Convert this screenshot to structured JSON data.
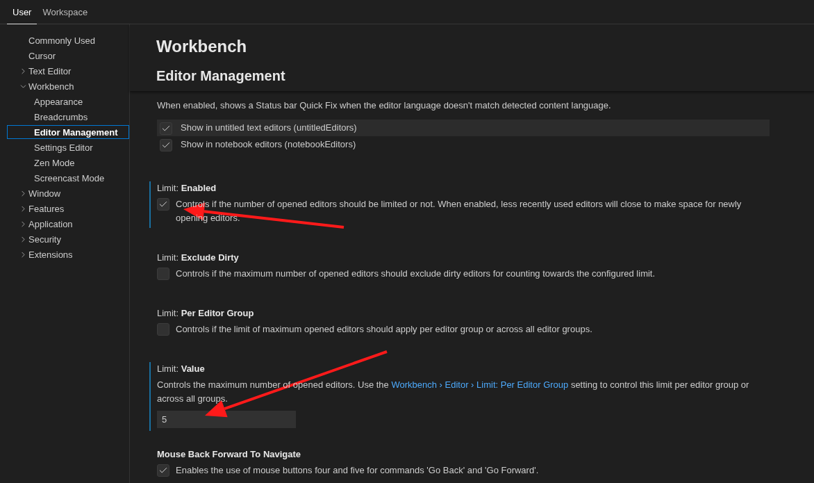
{
  "tabs": [
    {
      "label": "User",
      "selected": true
    },
    {
      "label": "Workspace",
      "selected": false
    }
  ],
  "sidebar": {
    "items": [
      {
        "label": "Commonly Used",
        "selected": false
      },
      {
        "label": "Cursor",
        "selected": false
      },
      {
        "label": "Text Editor",
        "selected": false,
        "expanded": false
      },
      {
        "label": "Workbench",
        "selected": false,
        "expanded": true,
        "children": [
          {
            "label": "Appearance",
            "selected": false
          },
          {
            "label": "Breadcrumbs",
            "selected": false
          },
          {
            "label": "Editor Management",
            "selected": true
          },
          {
            "label": "Settings Editor",
            "selected": false
          },
          {
            "label": "Zen Mode",
            "selected": false
          },
          {
            "label": "Screencast Mode",
            "selected": false
          }
        ]
      },
      {
        "label": "Window",
        "selected": false,
        "expanded": false
      },
      {
        "label": "Features",
        "selected": false,
        "expanded": false
      },
      {
        "label": "Application",
        "selected": false,
        "expanded": false
      },
      {
        "label": "Security",
        "selected": false,
        "expanded": false
      },
      {
        "label": "Extensions",
        "selected": false,
        "expanded": false
      }
    ]
  },
  "header": {
    "title": "Workbench",
    "subtitle": "Editor Management"
  },
  "settings": [
    {
      "kind": "checkbox_list",
      "focused": false,
      "arrow": false,
      "description": "When enabled, shows a Status bar Quick Fix when the editor language doesn't match detected content language.",
      "options": [
        {
          "label": "Show in untitled text editors (untitledEditors)",
          "checked": true,
          "highlighted": true
        },
        {
          "label": "Show in notebook editors (notebookEditors)",
          "checked": true,
          "highlighted": false
        }
      ]
    },
    {
      "kind": "checkbox",
      "category": "Limit: ",
      "name": "Enabled",
      "focused": true,
      "arrow": true,
      "checked": true,
      "description": "Controls if the number of opened editors should be limited or not. When enabled, less recently used editors will close to make space for newly opening editors."
    },
    {
      "kind": "checkbox",
      "category": "Limit: ",
      "name": "Exclude Dirty",
      "focused": false,
      "arrow": false,
      "checked": false,
      "description": "Controls if the maximum number of opened editors should exclude dirty editors for counting towards the configured limit."
    },
    {
      "kind": "checkbox",
      "category": "Limit: ",
      "name": "Per Editor Group",
      "focused": false,
      "arrow": false,
      "checked": false,
      "description": "Controls if the limit of maximum opened editors should apply per editor group or across all editor groups."
    },
    {
      "kind": "number",
      "category": "Limit: ",
      "name": "Value",
      "focused": true,
      "arrow": true,
      "description": "Controls the maximum number of opened editors. Use the",
      "link": "Workbench › Editor › Limit: Per Editor Group",
      "description_after": "setting to control this limit per editor group or across all groups.",
      "value": "5"
    },
    {
      "kind": "checkbox",
      "name": "Mouse Back Forward To Navigate",
      "focused": false,
      "arrow": false,
      "checked": true,
      "description": "Enables the use of mouse buttons four and five for commands 'Go Back' and 'Go Forward'."
    }
  ]
}
